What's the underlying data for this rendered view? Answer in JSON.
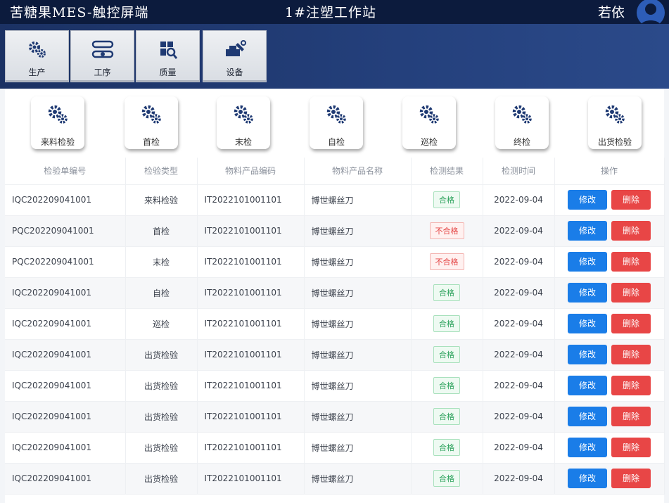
{
  "header": {
    "app_title": "苦糖果MES-触控屏端",
    "station": "1#注塑工作站",
    "user": "若依"
  },
  "nav": {
    "tabs": [
      {
        "label": "生产",
        "icon": "gears-icon"
      },
      {
        "label": "工序",
        "icon": "process-icon"
      },
      {
        "label": "质量",
        "icon": "quality-icon"
      },
      {
        "label": "设备",
        "icon": "equipment-icon"
      }
    ]
  },
  "inspection_types": [
    {
      "label": "来料检验"
    },
    {
      "label": "首检"
    },
    {
      "label": "末检"
    },
    {
      "label": "自检"
    },
    {
      "label": "巡检"
    },
    {
      "label": "终检"
    },
    {
      "label": "出货检验"
    }
  ],
  "table": {
    "columns": [
      "检验单编号",
      "检验类型",
      "物料产品编码",
      "物料产品名称",
      "检测结果",
      "检测时间",
      "操作"
    ],
    "rows": [
      {
        "no": "IQC202209041001",
        "type": "来料检验",
        "code": "IT2022101001101",
        "name": "博世螺丝刀",
        "result": "合格",
        "status": "ok",
        "date": "2022-09-04"
      },
      {
        "no": "PQC202209041001",
        "type": "首检",
        "code": "IT2022101001101",
        "name": "博世螺丝刀",
        "result": "不合格",
        "status": "bad",
        "date": "2022-09-04"
      },
      {
        "no": "PQC202209041001",
        "type": "末检",
        "code": "IT2022101001101",
        "name": "博世螺丝刀",
        "result": "不合格",
        "status": "bad",
        "date": "2022-09-04"
      },
      {
        "no": "IQC202209041001",
        "type": "自检",
        "code": "IT2022101001101",
        "name": "博世螺丝刀",
        "result": "合格",
        "status": "ok",
        "date": "2022-09-04"
      },
      {
        "no": "IQC202209041001",
        "type": "巡检",
        "code": "IT2022101001101",
        "name": "博世螺丝刀",
        "result": "合格",
        "status": "ok",
        "date": "2022-09-04"
      },
      {
        "no": "IQC202209041001",
        "type": "出货检验",
        "code": "IT2022101001101",
        "name": "博世螺丝刀",
        "result": "合格",
        "status": "ok",
        "date": "2022-09-04"
      },
      {
        "no": "IQC202209041001",
        "type": "出货检验",
        "code": "IT2022101001101",
        "name": "博世螺丝刀",
        "result": "合格",
        "status": "ok",
        "date": "2022-09-04"
      },
      {
        "no": "IQC202209041001",
        "type": "出货检验",
        "code": "IT2022101001101",
        "name": "博世螺丝刀",
        "result": "合格",
        "status": "ok",
        "date": "2022-09-04"
      },
      {
        "no": "IQC202209041001",
        "type": "出货检验",
        "code": "IT2022101001101",
        "name": "博世螺丝刀",
        "result": "合格",
        "status": "ok",
        "date": "2022-09-04"
      },
      {
        "no": "IQC202209041001",
        "type": "出货检验",
        "code": "IT2022101001101",
        "name": "博世螺丝刀",
        "result": "合格",
        "status": "ok",
        "date": "2022-09-04"
      }
    ],
    "edit_label": "修改",
    "delete_label": "删除"
  },
  "colors": {
    "topbar": "#0c1b3d",
    "nav_band": "#1b3163",
    "edit": "#1a7de8",
    "delete": "#e84646",
    "pass": "#2aa15a",
    "fail": "#e44646"
  }
}
